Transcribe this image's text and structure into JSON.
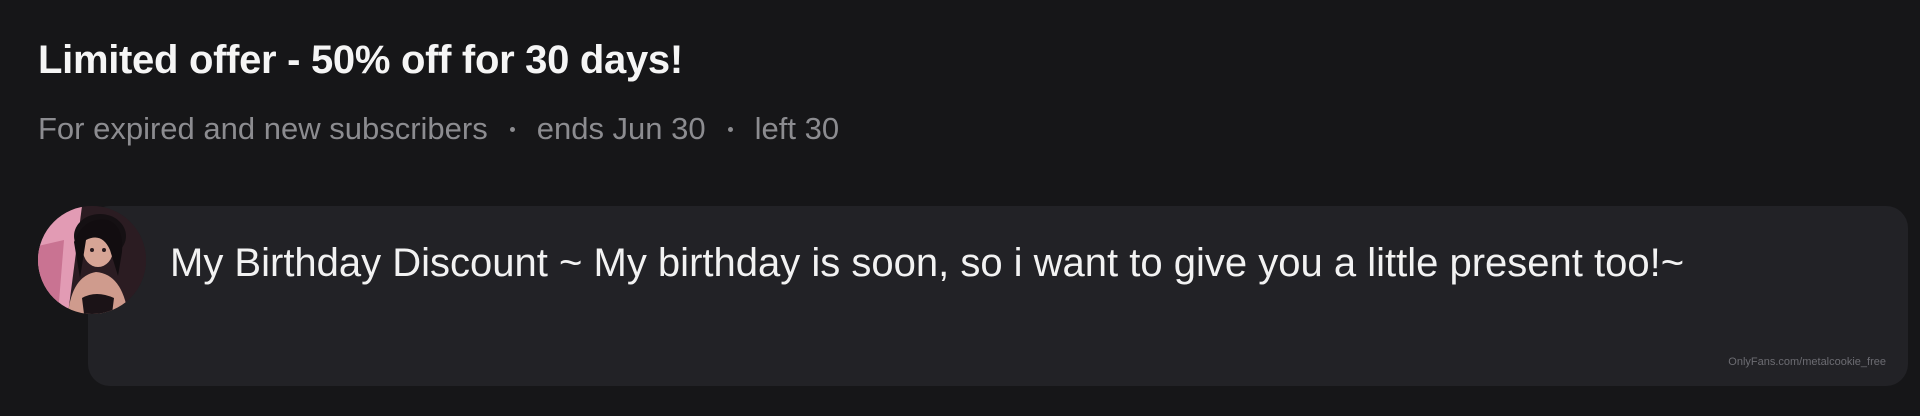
{
  "offer": {
    "title": "Limited offer - 50% off for 30 days!",
    "audience": "For expired and new subscribers",
    "ends": "ends Jun 30",
    "left": "left 30"
  },
  "message": {
    "text": "My Birthday Discount ~ My birthday is soon, so i want to give you a little present too!~",
    "watermark": "OnlyFans.com/metalcookie_free"
  },
  "colors": {
    "background": "#161618",
    "card": "#222226",
    "meta_text": "#8c8c90"
  }
}
